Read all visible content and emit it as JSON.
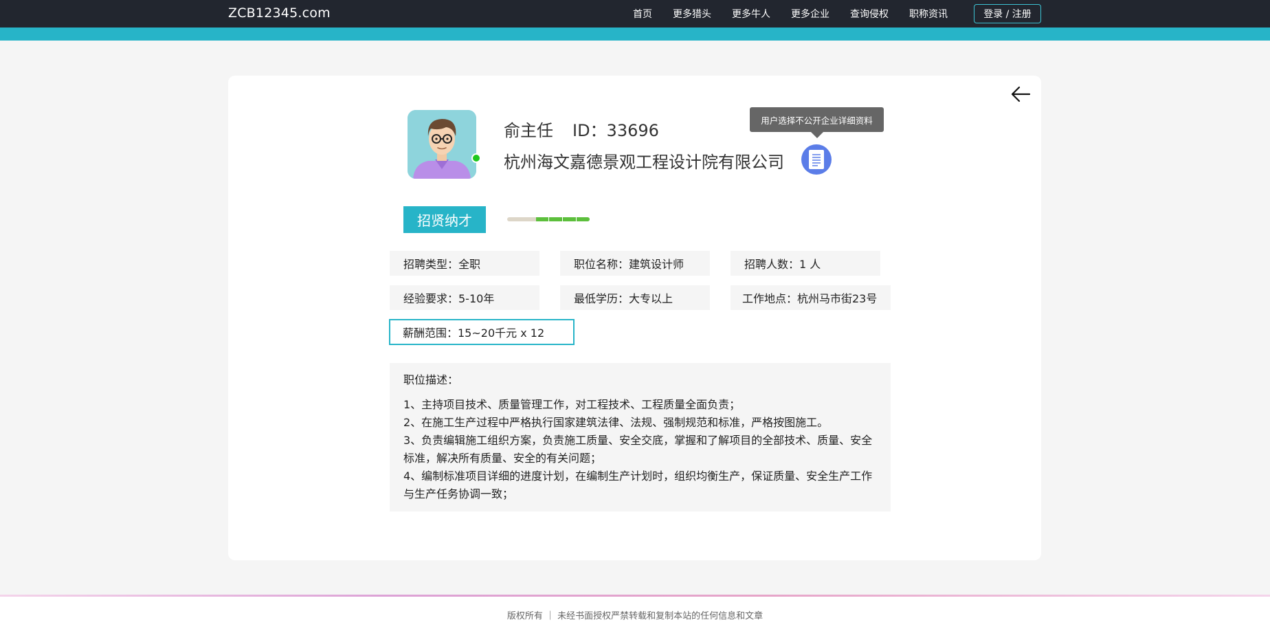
{
  "site": {
    "brand": "ZCB12345.com"
  },
  "nav": {
    "links": [
      "首页",
      "更多猎头",
      "更多牛人",
      "更多企业",
      "查询侵权",
      "职称资讯"
    ],
    "login_label": "登录 / 注册"
  },
  "profile": {
    "name": "俞主任",
    "id_text": "ID：33696",
    "company": "杭州海文嘉德景观工程设计院有限公司",
    "tooltip": "用户选择不公开企业详细资料",
    "online": true,
    "avatar_icon": "person-avatar-icon",
    "doc_icon": "document-icon"
  },
  "recruit": {
    "tag": "招贤纳才",
    "progress": 0.65,
    "fields": [
      "招聘类型：全职",
      "职位名称：建筑设计师",
      "招聘人数：1 人",
      "经验要求：5-10年",
      "最低学历：大专以上",
      "工作地点：杭州马市街23号"
    ],
    "salary": "薪酬范围：15~20千元 x 12"
  },
  "description": {
    "title": "职位描述：",
    "lines": [
      "1、主持项目技术、质量管理工作，对工程技术、工程质量全面负责；",
      "2、在施工生产过程中严格执行国家建筑法律、法规、强制规范和标准，严格按图施工。",
      "3、负责编辑施工组织方案，负责施工质量、安全交底，掌握和了解项目的全部技术、质量、安全标准，解决所有质量、安全的有关问题；",
      "4、编制标准项目详细的进度计划，在编制生产计划时，组织均衡生产，保证质量、安全生产工作与生产任务协调一致；"
    ]
  },
  "footer": {
    "text": "版权所有 ｜ 未经书面授权严禁转载和复制本站的任何信息和文章"
  },
  "colors": {
    "accent": "#27b4c8",
    "nav_bg": "#22262f",
    "online": "#1ec81e",
    "doc_button": "#5b7de8",
    "progress_fill": "#5cbf3c"
  }
}
